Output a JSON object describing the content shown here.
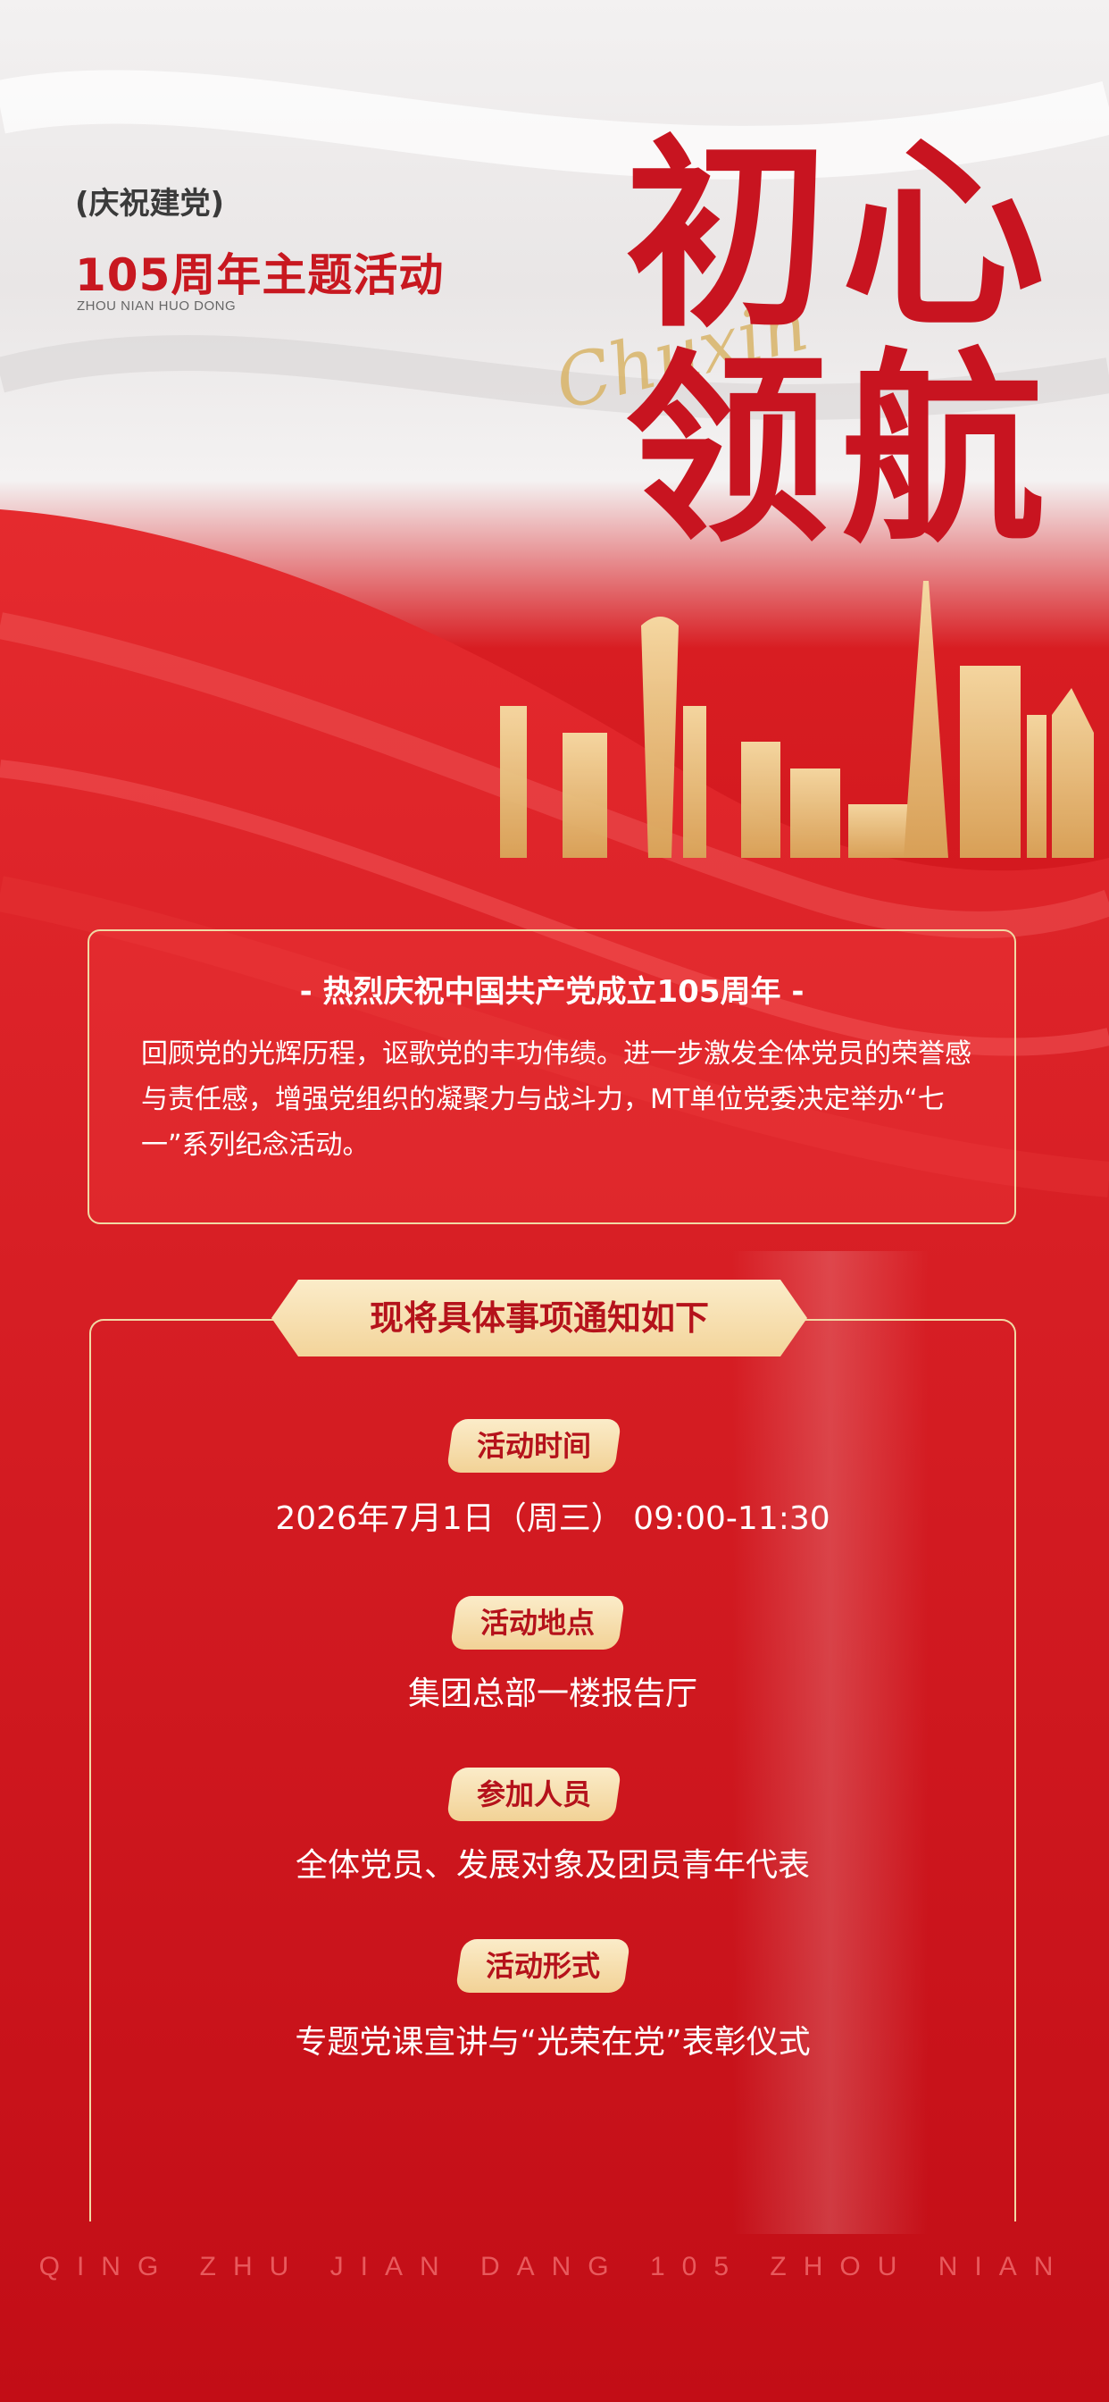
{
  "header": {
    "subtitle_top": "(庆祝建党)",
    "subtitle_main": "105周年主题活动",
    "subtitle_pinyin": "ZHOU NIAN HUO DONG"
  },
  "title": {
    "line1": "初心",
    "line2": "领航",
    "script": "Chuxin"
  },
  "intro": {
    "heading": "- 热烈庆祝中国共产党成立105周年 -",
    "body": "回顾党的光辉历程，讴歌党的丰功伟绩。进一步激发全体党员的荣誉感与责任感，增强党组织的凝聚力与战斗力，MT单位党委决定举办“七一”系列纪念活动。"
  },
  "notice": {
    "banner": "现将具体事项通知如下",
    "items": [
      {
        "label": "活动时间",
        "value": "2026年7月1日（周三） 09:00-11:30"
      },
      {
        "label": "活动地点",
        "value": "集团总部一楼报告厅"
      },
      {
        "label": "参加人员",
        "value": "全体党员、发展对象及团员青年代表"
      },
      {
        "label": "活动形式",
        "value": "专题党课宣讲与“光荣在党”表彰仪式"
      }
    ]
  },
  "footer": "QING ZHU JIAN DANG 105 ZHOU NIAN",
  "colors": {
    "primary_red": "#c81420",
    "gold": "#f1d9a4",
    "white": "#ffffff"
  }
}
